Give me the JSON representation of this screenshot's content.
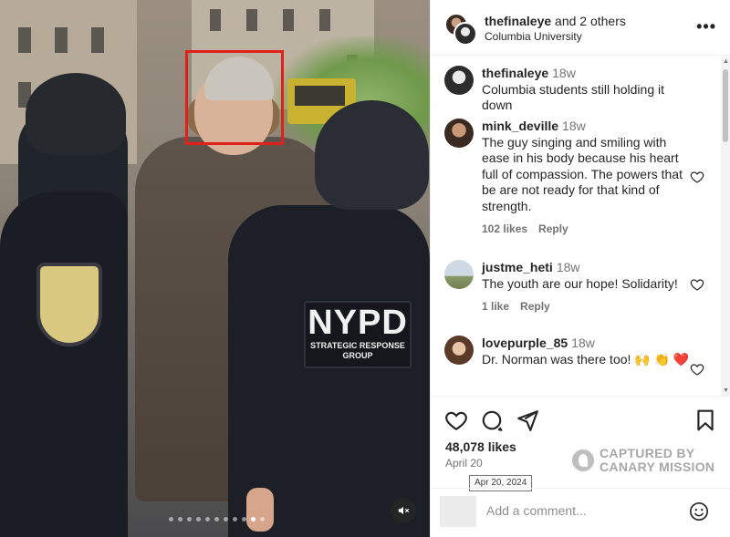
{
  "post": {
    "author": "thefinaleye",
    "coauthors": "and 2 others",
    "location": "Columbia University",
    "more_icon": "more-icon",
    "media": {
      "patch_title": "NYPD",
      "patch_sub_1": "STRATEGIC RESPONSE",
      "patch_sub_2": "GROUP",
      "carousel_dots": 11,
      "active_dot": 10
    }
  },
  "comments": [
    {
      "user": "thefinaleye",
      "time": "18w",
      "text": "Columbia students still holding it down",
      "likes": "",
      "reply": ""
    },
    {
      "user": "mink_deville",
      "time": "18w",
      "text": "The guy singing and smiling with ease in his body because his heart full of compassion. The powers that be are not ready for that kind of strength.",
      "likes": "102 likes",
      "reply": "Reply"
    },
    {
      "user": "justme_heti",
      "time": "18w",
      "text": "The youth are our hope! Solidarity!",
      "likes": "1 like",
      "reply": "Reply"
    },
    {
      "user": "lovepurple_85",
      "time": "18w",
      "text": "Dr. Norman was there too! 🙌 👏 ❤️",
      "likes": "",
      "reply": ""
    }
  ],
  "footer": {
    "likes": "48,078 likes",
    "date": "April 20",
    "date_tooltip": "Apr 20, 2024",
    "watermark_line1": "CAPTURED BY",
    "watermark_line2": "CANARY MISSION",
    "add_comment_placeholder": "Add a comment..."
  },
  "colors": {
    "highlight_box": "#e0201b",
    "muted_text": "#737373",
    "divider": "#efefef"
  }
}
